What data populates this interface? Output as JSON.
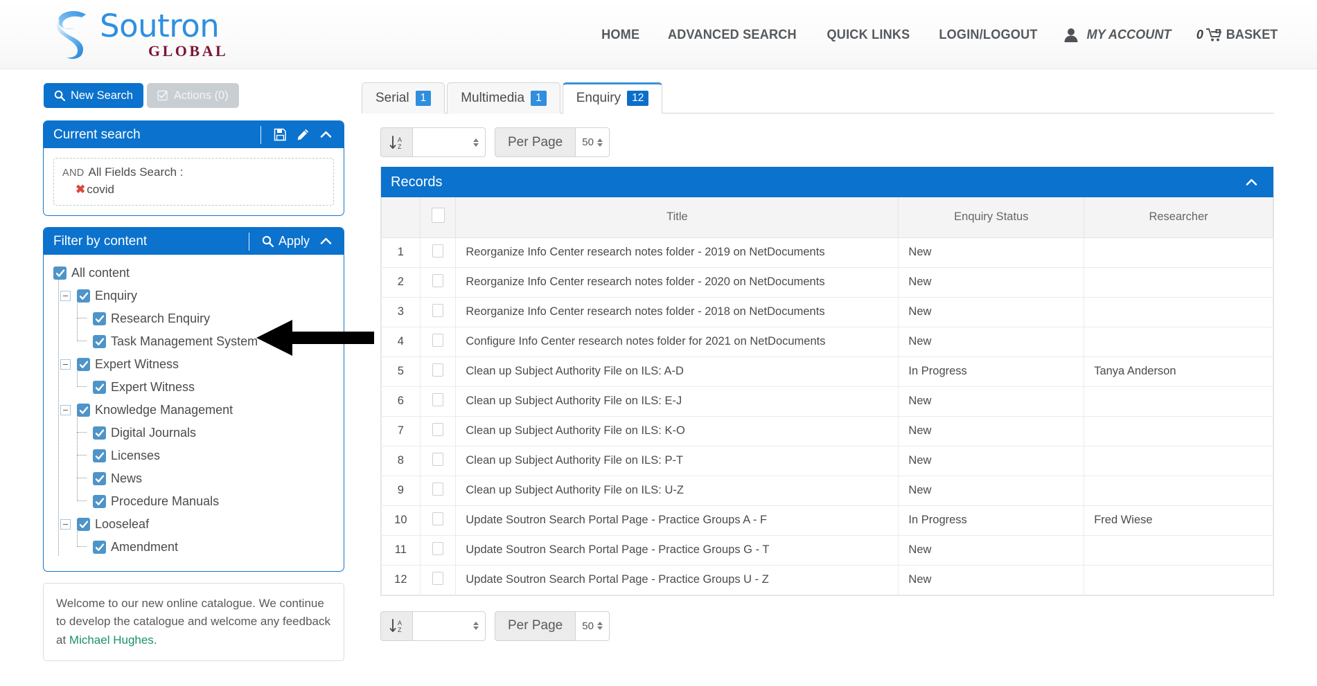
{
  "header": {
    "logo": {
      "primary": "Soutron",
      "secondary": "GLOBAL",
      "mark": "ribbon-swoosh-icon"
    },
    "nav": [
      {
        "label": "HOME",
        "name": "nav-home"
      },
      {
        "label": "ADVANCED SEARCH",
        "name": "nav-advanced-search"
      },
      {
        "label": "QUICK LINKS",
        "name": "nav-quick-links"
      },
      {
        "label": "LOGIN/LOGOUT",
        "name": "nav-login-logout"
      }
    ],
    "account": {
      "label": "MY ACCOUNT",
      "icon": "person-icon"
    },
    "basket": {
      "count": "0",
      "label": "BASKET",
      "icon": "cart-plus-icon"
    }
  },
  "toolbar": {
    "new_search": "New Search",
    "new_search_icon": "search-icon",
    "actions": "Actions (0)",
    "actions_icon": "checked-box-icon"
  },
  "current_search": {
    "title": "Current search",
    "icons": [
      "save-icon",
      "edit-pencil-icon",
      "chevron-up-icon"
    ],
    "operator": "AND",
    "field": "All Fields Search :",
    "term": "covid",
    "remove_glyph": "✖"
  },
  "filter_panel": {
    "title": "Filter by content",
    "apply": "Apply",
    "apply_icon": "search-icon",
    "collapse_icon": "chevron-up-icon",
    "tree": [
      {
        "label": "All content",
        "level": 0,
        "checked": true,
        "expander": false
      },
      {
        "label": "Enquiry",
        "level": 1,
        "checked": true,
        "expander": true
      },
      {
        "label": "Research Enquiry",
        "level": 2,
        "checked": true,
        "expander": false
      },
      {
        "label": "Task Management System",
        "level": 2,
        "checked": true,
        "expander": false
      },
      {
        "label": "Expert Witness",
        "level": 1,
        "checked": true,
        "expander": true
      },
      {
        "label": "Expert Witness",
        "level": 2,
        "checked": true,
        "expander": false
      },
      {
        "label": "Knowledge Management",
        "level": 1,
        "checked": true,
        "expander": true
      },
      {
        "label": "Digital Journals",
        "level": 2,
        "checked": true,
        "expander": false
      },
      {
        "label": "Licenses",
        "level": 2,
        "checked": true,
        "expander": false
      },
      {
        "label": "News",
        "level": 2,
        "checked": true,
        "expander": false
      },
      {
        "label": "Procedure Manuals",
        "level": 2,
        "checked": true,
        "expander": false
      },
      {
        "label": "Looseleaf",
        "level": 1,
        "checked": true,
        "expander": true
      },
      {
        "label": "Amendment",
        "level": 2,
        "checked": true,
        "expander": false
      }
    ]
  },
  "annotation": {
    "type": "arrow-pointing-left",
    "target": "Task Management System"
  },
  "welcome": {
    "text_before": "Welcome to our new online catalogue. We continue to develop the catalogue and welcome any feedback at ",
    "link": "Michael Hughes",
    "text_after": "."
  },
  "tabs": [
    {
      "label": "Serial",
      "count": "1",
      "active": false
    },
    {
      "label": "Multimedia",
      "count": "1",
      "active": false
    },
    {
      "label": "Enquiry",
      "count": "12",
      "active": true
    }
  ],
  "results_tools": {
    "sort_icon": "sort-alpha-down-icon",
    "sort_value": "",
    "per_page_label": "Per Page",
    "per_page_value": "50"
  },
  "records": {
    "title": "Records",
    "collapse_icon": "chevron-up-icon",
    "columns": [
      "",
      "",
      "Title",
      "Enquiry Status",
      "Researcher"
    ],
    "rows": [
      {
        "num": "1",
        "title": "Reorganize Info Center research notes folder - 2019 on NetDocuments",
        "status": "New",
        "researcher": ""
      },
      {
        "num": "2",
        "title": "Reorganize Info Center research notes folder - 2020 on NetDocuments",
        "status": "New",
        "researcher": ""
      },
      {
        "num": "3",
        "title": "Reorganize Info Center research notes folder - 2018 on NetDocuments",
        "status": "New",
        "researcher": ""
      },
      {
        "num": "4",
        "title": "Configure Info Center research notes folder for 2021 on NetDocuments",
        "status": "New",
        "researcher": ""
      },
      {
        "num": "5",
        "title": "Clean up Subject Authority File on ILS: A-D",
        "status": "In Progress",
        "researcher": "Tanya Anderson"
      },
      {
        "num": "6",
        "title": "Clean up Subject Authority File on ILS: E-J",
        "status": "New",
        "researcher": ""
      },
      {
        "num": "7",
        "title": "Clean up Subject Authority File on ILS: K-O",
        "status": "New",
        "researcher": ""
      },
      {
        "num": "8",
        "title": "Clean up Subject Authority File on ILS: P-T",
        "status": "New",
        "researcher": ""
      },
      {
        "num": "9",
        "title": "Clean up Subject Authority File on ILS: U-Z",
        "status": "New",
        "researcher": ""
      },
      {
        "num": "10",
        "title": "Update Soutron Search Portal Page - Practice Groups A - F",
        "status": "In Progress",
        "researcher": "Fred Wiese"
      },
      {
        "num": "11",
        "title": "Update Soutron Search Portal Page - Practice Groups G - T",
        "status": "New",
        "researcher": ""
      },
      {
        "num": "12",
        "title": "Update Soutron Search Portal Page - Practice Groups U - Z",
        "status": "New",
        "researcher": ""
      }
    ]
  },
  "colors": {
    "brand_blue": "#0b72cd",
    "logo_blue": "#2f8fe0",
    "logo_maroon": "#7b1535",
    "link_green": "#1b9263",
    "badge_blue": "#2f8ede"
  }
}
